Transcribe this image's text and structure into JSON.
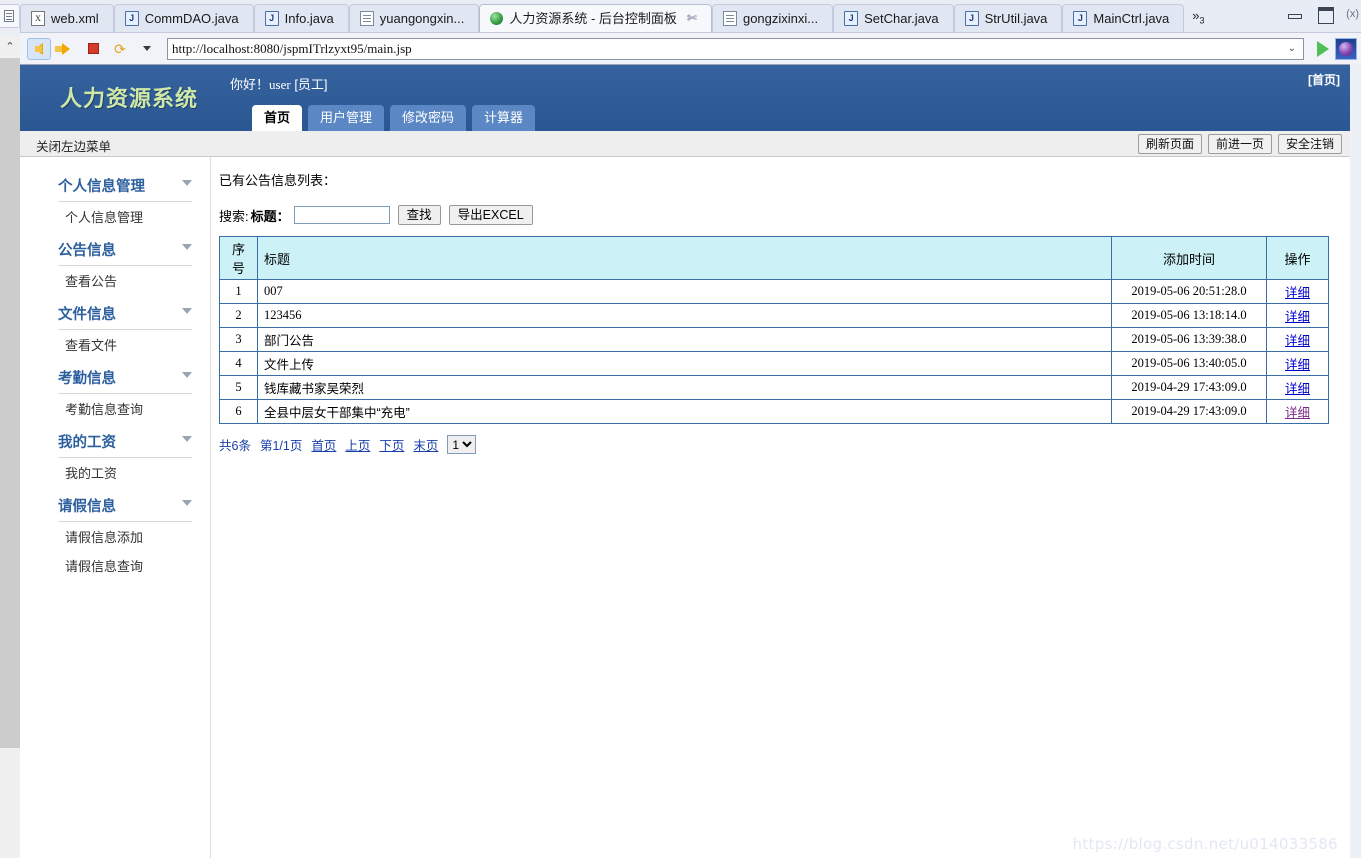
{
  "ide": {
    "tabs": [
      {
        "label": "web.xml",
        "icon": "xml-file-icon",
        "icon_text": "X",
        "active": false,
        "closable": false
      },
      {
        "label": "CommDAO.java",
        "icon": "java-file-warning-icon",
        "icon_text": "J",
        "active": false,
        "closable": false
      },
      {
        "label": "Info.java",
        "icon": "java-file-warning-icon",
        "icon_text": "J",
        "active": false,
        "closable": false
      },
      {
        "label": "yuangongxin...",
        "icon": "jsp-file-icon",
        "icon_text": "",
        "active": false,
        "closable": false
      },
      {
        "label": "人力资源系统 - 后台控制面板",
        "icon": "globe-icon",
        "icon_text": "",
        "active": true,
        "closable": true
      },
      {
        "label": "gongzixinxi...",
        "icon": "jsp-file-icon",
        "icon_text": "",
        "active": false,
        "closable": false
      },
      {
        "label": "SetChar.java",
        "icon": "java-file-warning-icon",
        "icon_text": "J",
        "active": false,
        "closable": false
      },
      {
        "label": "StrUtil.java",
        "icon": "java-file-icon",
        "icon_text": "J",
        "active": false,
        "closable": false
      },
      {
        "label": "MainCtrl.java",
        "icon": "java-file-warning-icon",
        "icon_text": "J",
        "active": false,
        "closable": false
      }
    ],
    "more_tabs_label": "»",
    "more_tabs_count": "3",
    "close_glyph": "✄",
    "right_edge_label": "(x)",
    "toolbar": {
      "back_icon": "back-arrow-icon",
      "forward_icon": "forward-arrow-icon",
      "stop_icon": "stop-icon",
      "refresh_icon": "refresh-icon",
      "dropdown_icon": "chevron-down-icon",
      "url": "http://localhost:8080/jspmITrlzyxt95/main.jsp",
      "url_dropdown_glyph": "⌄",
      "go_icon": "go-play-icon",
      "browser_icon": "internet-explorer-icon"
    }
  },
  "page": {
    "header": {
      "brand": "人力资源系统",
      "greeting_prefix": "你好！",
      "username": "user",
      "role": "[员工]",
      "home_link": "[首页]",
      "tabs": [
        {
          "label": "首页",
          "active": true
        },
        {
          "label": "用户管理",
          "active": false
        },
        {
          "label": "修改密码",
          "active": false
        },
        {
          "label": "计算器",
          "active": false
        }
      ]
    },
    "subbar": {
      "close_menu": "关闭左边菜单",
      "buttons": [
        "刷新页面",
        "前进一页",
        "安全注销"
      ]
    },
    "sidebar": {
      "groups": [
        {
          "title": "个人信息管理",
          "items": [
            "个人信息管理"
          ]
        },
        {
          "title": "公告信息",
          "items": [
            "查看公告"
          ]
        },
        {
          "title": "文件信息",
          "items": [
            "查看文件"
          ]
        },
        {
          "title": "考勤信息",
          "items": [
            "考勤信息查询"
          ]
        },
        {
          "title": "我的工资",
          "items": [
            "我的工资"
          ]
        },
        {
          "title": "请假信息",
          "items": [
            "请假信息添加",
            "请假信息查询"
          ]
        }
      ]
    },
    "content": {
      "list_title": "已有公告信息列表：",
      "search": {
        "label": "搜索:",
        "field_label": "标题：",
        "value": "",
        "placeholder": "",
        "find_button": "查找",
        "export_button": "导出EXCEL"
      },
      "table": {
        "headers": [
          "序号",
          "标题",
          "添加时间",
          "操作"
        ],
        "rows": [
          {
            "idx": "1",
            "title": "007",
            "time": "2019-05-06 20:51:28.0",
            "action": "详细",
            "visited": false
          },
          {
            "idx": "2",
            "title": "123456",
            "time": "2019-05-06 13:18:14.0",
            "action": "详细",
            "visited": false
          },
          {
            "idx": "3",
            "title": "部门公告",
            "time": "2019-05-06 13:39:38.0",
            "action": "详细",
            "visited": false
          },
          {
            "idx": "4",
            "title": "文件上传",
            "time": "2019-05-06 13:40:05.0",
            "action": "详细",
            "visited": false
          },
          {
            "idx": "5",
            "title": "钱库藏书家吴荣烈",
            "time": "2019-04-29 17:43:09.0",
            "action": "详细",
            "visited": false
          },
          {
            "idx": "6",
            "title": "全县中层女干部集中“充电”",
            "time": "2019-04-29 17:43:09.0",
            "action": "详细",
            "visited": true
          }
        ]
      },
      "pager": {
        "total": "共6条",
        "page_info": "第1/1页",
        "first": "首页",
        "prev": "上页",
        "next": "下页",
        "last": "末页",
        "selected_page": "1",
        "page_options": [
          "1"
        ]
      },
      "watermark": "https://blog.csdn.net/u014033586"
    }
  }
}
